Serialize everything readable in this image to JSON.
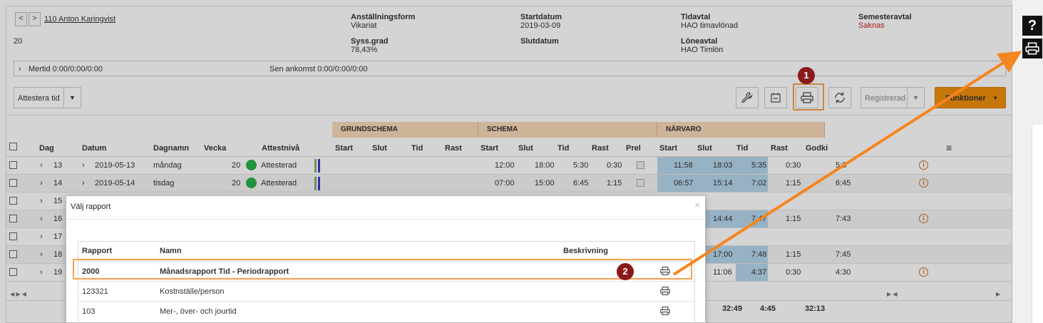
{
  "header": {
    "nav_prev": "<",
    "nav_next": ">",
    "employee_name": "110 Anton Karingvist",
    "employee_number": "20",
    "fields": [
      {
        "label": "Anställningsform",
        "value": "Vikariat"
      },
      {
        "label": "Syss.grad",
        "value": "78,43%"
      },
      {
        "label": "Startdatum",
        "value": "2019-03-09"
      },
      {
        "label": "Slutdatum",
        "value": ""
      },
      {
        "label": "Tidavtal",
        "value": "HAO timavlönad"
      },
      {
        "label": "Löneavtal",
        "value": "HAO Timlön"
      },
      {
        "label": "Semesteravtal",
        "value": "Saknas"
      }
    ],
    "mertid": "Mertid 0:00/0:00/0:00",
    "sen_ankomst": "Sen ankomst 0:00/0:00/0:00"
  },
  "toolbar": {
    "attest_label": "Attestera tid",
    "registered_label": "Registrerad",
    "functions_label": "Funktioner"
  },
  "table": {
    "groups": [
      "GRUNDSCHEMA",
      "SCHEMA",
      "NÄRVARO"
    ],
    "headers": [
      "Dag",
      "Datum",
      "Dagnamn",
      "Vecka",
      "Attestnivå",
      "Start",
      "Slut",
      "Tid",
      "Rast",
      "Start",
      "Slut",
      "Tid",
      "Rast",
      "Prel",
      "Start",
      "Slut",
      "Tid",
      "Rast",
      "Godki"
    ],
    "rows": [
      {
        "dag": "13",
        "datum": "2019-05-13",
        "dagnamn": "måndag",
        "vecka": "20",
        "attest": "Attesterad",
        "s_start": "12:00",
        "s_slut": "18:00",
        "s_tid": "5:30",
        "s_rast": "0:30",
        "n_start": "11:58",
        "n_slut": "18:03",
        "n_tid": "5:35",
        "n_rast": "0:30",
        "godk": "5:3"
      },
      {
        "dag": "14",
        "datum": "2019-05-14",
        "dagnamn": "tisdag",
        "vecka": "20",
        "attest": "Attesterad",
        "s_start": "07:00",
        "s_slut": "15:00",
        "s_tid": "6:45",
        "s_rast": "1:15",
        "n_start": "06:57",
        "n_slut": "15:14",
        "n_tid": "7:02",
        "n_rast": "1:15",
        "godk": "6:45"
      },
      {
        "dag": "15",
        "n_slut": "",
        "n_tid": "",
        "n_rast": "",
        "godk": ""
      },
      {
        "dag": "16",
        "n_slut": "14:44",
        "n_tid": "7:47",
        "n_rast": "1:15",
        "godk": "7:43"
      },
      {
        "dag": "17",
        "n_slut": "",
        "n_tid": "",
        "n_rast": "",
        "godk": ""
      },
      {
        "dag": "18",
        "n_slut": "17:00",
        "n_tid": "7:48",
        "n_rast": "1:15",
        "godk": "7:45"
      },
      {
        "dag": "19",
        "n_slut": "11:06",
        "n_tid": "4:37",
        "n_rast": "0:30",
        "godk": "4:30"
      }
    ],
    "totals": {
      "tid": "32:49",
      "rast": "4:45",
      "godk": "32:13"
    }
  },
  "modal": {
    "title": "Välj rapport",
    "close": "×",
    "columns": [
      "Rapport",
      "Namn",
      "Beskrivning"
    ],
    "rows": [
      {
        "id": "2000",
        "name": "Månadsrapport Tid - Periodrapport",
        "desc": ""
      },
      {
        "id": "123321",
        "name": "Kostnställe/person",
        "desc": ""
      },
      {
        "id": "103",
        "name": "Mer-, över- och jourtid",
        "desc": ""
      }
    ]
  },
  "annotations": {
    "step1": "1",
    "step2": "2"
  },
  "side": {
    "help": "?"
  },
  "colors": {
    "accent": "#f0900d",
    "highlight": "#f5a04d",
    "badge": "#8b1a1a",
    "status_green": "#27b34a",
    "narvaro_blue": "#b6d7ed"
  }
}
